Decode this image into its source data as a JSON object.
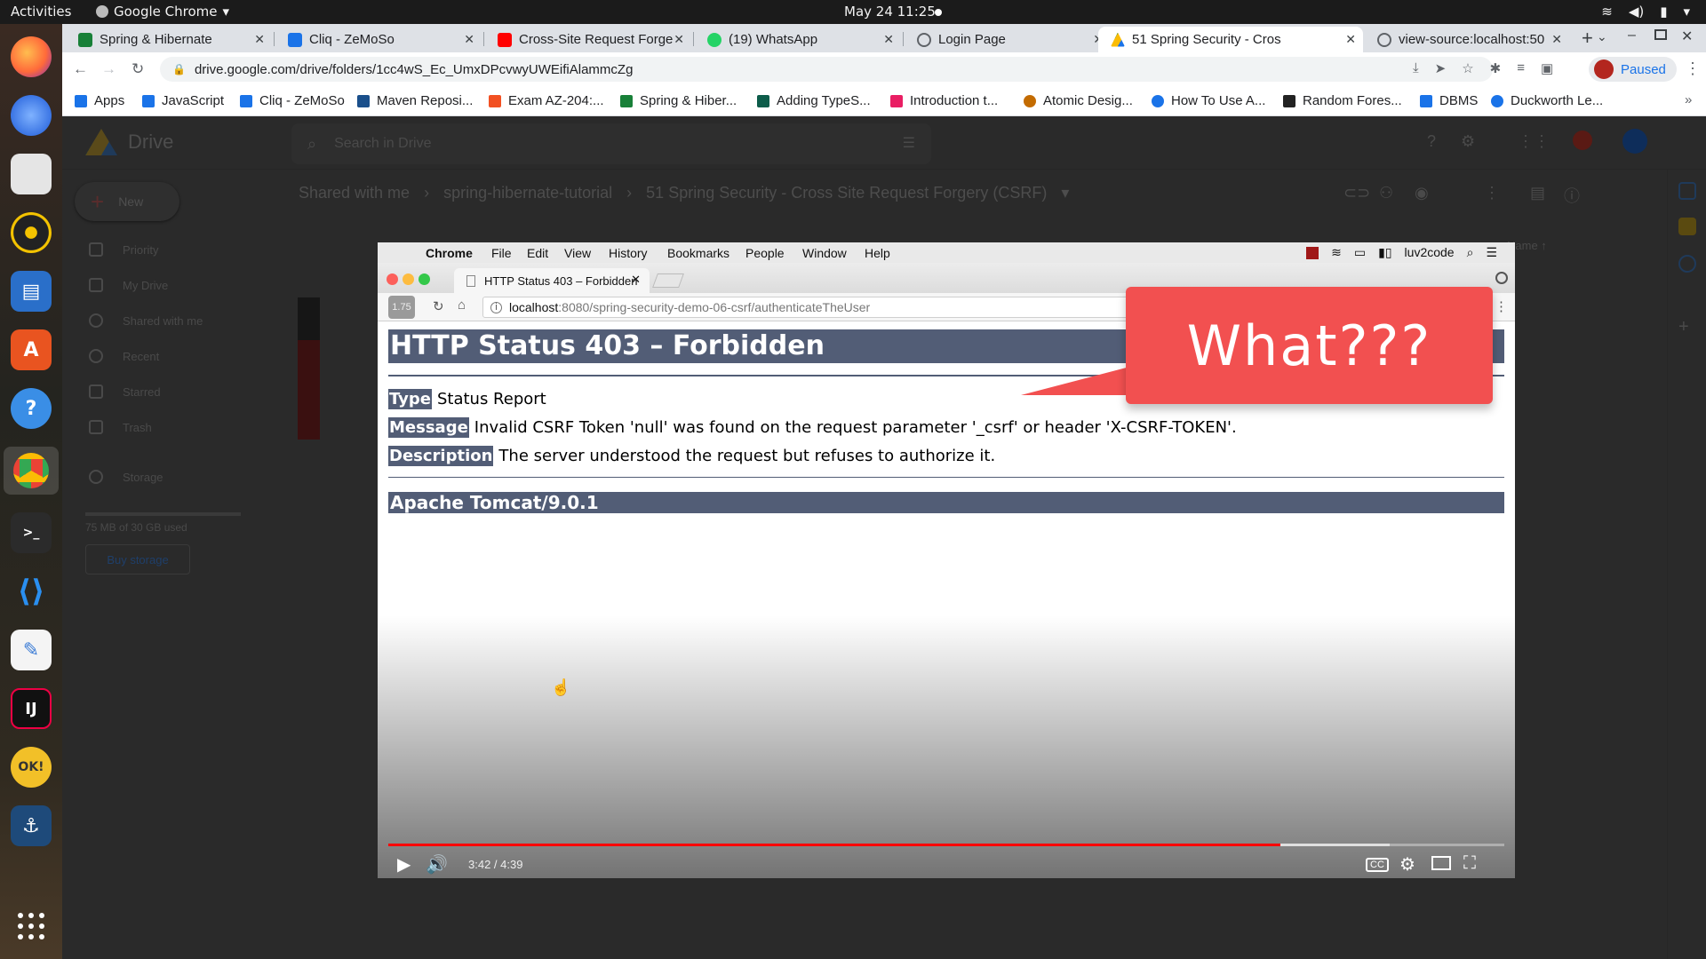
{
  "system": {
    "activities": "Activities",
    "app_name": "Google Chrome",
    "clock": "May 24  11:25"
  },
  "dock": {
    "items": [
      "firefox",
      "thunderbird",
      "files",
      "rhythmbox",
      "writer",
      "software",
      "help",
      "chrome",
      "terminal",
      "vscode",
      "text-editor",
      "intellij",
      "okular",
      "mysql-workbench"
    ]
  },
  "browser": {
    "tabs": [
      {
        "title": "Spring & Hibernate",
        "color": "#188038"
      },
      {
        "title": "Cliq - ZeMoSo",
        "color": "#1a73e8"
      },
      {
        "title": "Cross-Site Request Forge",
        "color": "#ff0000"
      },
      {
        "title": "(19) WhatsApp",
        "color": "#25d366"
      },
      {
        "title": "Login Page",
        "color": "#5f6368"
      },
      {
        "title": "51 Spring Security - Cros",
        "color": "#fbbc04"
      },
      {
        "title": "view-source:localhost:50",
        "color": "#5f6368"
      }
    ],
    "url": "drive.google.com/drive/folders/1cc4wS_Ec_UmxDPcvwyUWEifiAlammcZg",
    "profile_status": "Paused",
    "bookmarks": [
      {
        "label": "Apps",
        "color": "#1a73e8"
      },
      {
        "label": "JavaScript",
        "color": "#1a73e8"
      },
      {
        "label": "Cliq - ZeMoSo",
        "color": "#1a73e8"
      },
      {
        "label": "Maven Reposi...",
        "color": "#1a4f8b"
      },
      {
        "label": "Exam AZ-204:...",
        "color": "#f25022"
      },
      {
        "label": "Spring & Hiber...",
        "color": "#188038"
      },
      {
        "label": "Adding TypeS...",
        "color": "#0d5c4a"
      },
      {
        "label": "Introduction t...",
        "color": "#e91e63"
      },
      {
        "label": "Atomic Desig...",
        "color": "#c36b00"
      },
      {
        "label": "How To Use A...",
        "color": "#1a73e8"
      },
      {
        "label": "Random Fores...",
        "color": "#222222"
      },
      {
        "label": "DBMS",
        "color": "#1a73e8"
      },
      {
        "label": "Duckworth Le...",
        "color": "#1a73e8"
      }
    ]
  },
  "drive": {
    "product": "Drive",
    "search_placeholder": "Search in Drive",
    "new_label": "New",
    "nav": [
      "Priority",
      "My Drive",
      "Shared with me",
      "Recent",
      "Starred",
      "Trash",
      "Storage"
    ],
    "storage_text": "75 MB of 30 GB used",
    "buy_storage": "Buy storage",
    "breadcrumb": [
      "Shared with me",
      "spring-hibernate-tutorial",
      "51 Spring Security - Cross Site Request Forgery (CSRF)"
    ],
    "column_name": "Name"
  },
  "video": {
    "mac_menu": [
      "Chrome",
      "File",
      "Edit",
      "View",
      "History",
      "Bookmarks",
      "People",
      "Window",
      "Help"
    ],
    "mac_user": "luv2code",
    "inner_tab_title": "HTTP Status 403 – Forbidden",
    "inner_url_host": "localhost",
    "inner_url_path": ":8080/spring-security-demo-06-csrf/authenticateTheUser",
    "speed_label": "1.75",
    "error": {
      "title": "HTTP Status 403 – Forbidden",
      "type_label": "Type",
      "type_value": "Status Report",
      "message_label": "Message",
      "message_value": "Invalid CSRF Token 'null' was found on the request parameter '_csrf' or header 'X-CSRF-TOKEN'.",
      "description_label": "Description",
      "description_value": "The server understood the request but refuses to authorize it.",
      "footer": "Apache Tomcat/9.0.1"
    },
    "callout": "What???",
    "time": "3:42 / 4:39",
    "played_fraction": 0.799,
    "buffered_fraction": 0.897
  }
}
